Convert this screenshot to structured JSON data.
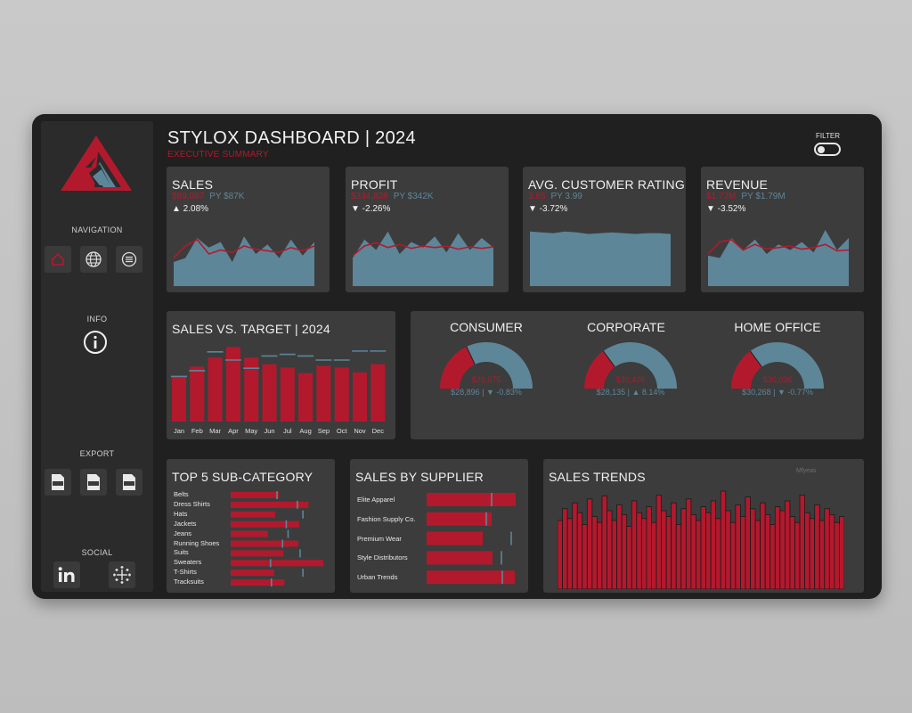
{
  "header": {
    "title": "STYLOX DASHBOARD  | 2024",
    "subtitle": "EXECUTIVE SUMMARY",
    "filter_label": "FILTER"
  },
  "sidebar": {
    "navigation_label": "NAVIGATION",
    "info_label": "INFO",
    "export_label": "EXPORT",
    "social_label": "SOCIAL",
    "nav_icons": [
      "home-icon",
      "globe-icon",
      "list-icon"
    ],
    "export_icons": [
      "png-file-icon",
      "pdf-file-icon",
      "ppt-file-icon"
    ],
    "social_icons": [
      "linkedin-icon",
      "tableau-icon"
    ]
  },
  "kpis": [
    {
      "title": "SALES",
      "current": "$89,087",
      "py": "PY $87K",
      "change": "▲ 2.08%"
    },
    {
      "title": "PROFIT",
      "current": "$334,828",
      "py": "PY $342K",
      "change": "▼ -2.26%"
    },
    {
      "title": "AVG. CUSTOMER RATING",
      "current": "3.85",
      "py": "PY 3.99",
      "change": "▼ -3.72%"
    },
    {
      "title": "REVENUE",
      "current": "$1.73M",
      "py": "PY $1.79M",
      "change": "▼ -3.52%"
    }
  ],
  "sales_vs_target": {
    "title": "SALES VS. TARGET | 2024",
    "months": [
      "Jan",
      "Feb",
      "Mar",
      "Apr",
      "May",
      "Jun",
      "Jul",
      "Aug",
      "Sep",
      "Oct",
      "Nov",
      "Dec"
    ]
  },
  "segments": [
    {
      "name": "CONSUMER",
      "value": "$29,075",
      "footer": "$28,896 |  ▼ -0.83%",
      "share": 0.36
    },
    {
      "name": "CORPORATE",
      "value": "$30,426",
      "footer": "$28,135 |  ▲ 8.14%",
      "share": 0.3
    },
    {
      "name": "HOME OFFICE",
      "value": "$30,036",
      "footer": "$30,268 |  ▼ -0.77%",
      "share": 0.3
    }
  ],
  "top5": {
    "title": "TOP 5 SUB-CATEGORY",
    "items": [
      "Belts",
      "Dress Shirts",
      "Hats",
      "Jackets",
      "Jeans",
      "Running Shoes",
      "Suits",
      "Sweaters",
      "T-Shirts",
      "Tracksuits"
    ]
  },
  "supplier": {
    "title": "SALES BY SUPPLIER",
    "items": [
      "Elite Apparel",
      "Fashion Supply Co.",
      "Premium Wear",
      "Style Distributors",
      "Urban Trends"
    ]
  },
  "trends": {
    "title": "SALES TRENDS",
    "legend": "Mfyeas"
  },
  "colors": {
    "accent_red": "#b3192d",
    "steel_blue": "#5d8699",
    "card_bg": "#3c3c3c",
    "panel_bg": "#202020"
  },
  "chart_data": [
    {
      "type": "area",
      "title": "SALES",
      "series": [
        {
          "values": [
            30,
            35,
            60,
            48,
            55,
            30,
            62,
            40,
            52,
            35,
            58,
            38,
            55
          ]
        },
        {
          "values": [
            35,
            50,
            58,
            40,
            45,
            42,
            50,
            46,
            44,
            42,
            48,
            44,
            50
          ]
        }
      ]
    },
    {
      "type": "area",
      "title": "PROFIT",
      "series": [
        {
          "values": [
            35,
            58,
            45,
            68,
            40,
            55,
            48,
            62,
            42,
            66,
            45,
            60,
            48
          ]
        },
        {
          "values": [
            38,
            50,
            54,
            48,
            52,
            47,
            50,
            48,
            50,
            46,
            49,
            47,
            49
          ]
        }
      ]
    },
    {
      "type": "area",
      "title": "AVG. CUSTOMER RATING",
      "series": [
        {
          "values": [
            68,
            67,
            66,
            68,
            67,
            65,
            66,
            67,
            66,
            65,
            66,
            66,
            65
          ]
        }
      ]
    },
    {
      "type": "area",
      "title": "REVENUE",
      "series": [
        {
          "values": [
            38,
            35,
            60,
            45,
            58,
            40,
            52,
            45,
            55,
            42,
            70,
            45,
            60
          ]
        },
        {
          "values": [
            40,
            55,
            58,
            45,
            52,
            46,
            48,
            50,
            46,
            48,
            52,
            44,
            45
          ]
        }
      ]
    },
    {
      "type": "bar",
      "title": "SALES VS. TARGET | 2024",
      "categories": [
        "Jan",
        "Feb",
        "Mar",
        "Apr",
        "May",
        "Jun",
        "Jul",
        "Aug",
        "Sep",
        "Oct",
        "Nov",
        "Dec"
      ],
      "series": [
        {
          "values": [
            56,
            67,
            78,
            91,
            78,
            70,
            66,
            59,
            68,
            66,
            60,
            70
          ]
        },
        {
          "values": [
            55,
            62,
            85,
            75,
            65,
            80,
            82,
            80,
            75,
            75,
            86,
            86
          ]
        }
      ]
    },
    {
      "type": "bar",
      "title": "TOP 5 SUB-CATEGORY",
      "categories": [
        "Belts",
        "Dress Shirts",
        "Hats",
        "Jackets",
        "Jeans",
        "Running Shoes",
        "Suits",
        "Sweaters",
        "T-Shirts",
        "Tracksuits"
      ],
      "series": [
        {
          "values": [
            52,
            84,
            48,
            74,
            40,
            73,
            57,
            100,
            47,
            58
          ]
        },
        {
          "values": [
            50,
            72,
            78,
            60,
            62,
            56,
            75,
            43,
            78,
            44
          ]
        }
      ]
    },
    {
      "type": "bar",
      "title": "SALES BY SUPPLIER",
      "categories": [
        "Elite Apparel",
        "Fashion Supply Co.",
        "Premium Wear",
        "Style Distributors",
        "Urban Trends"
      ],
      "series": [
        {
          "values": [
            100,
            73,
            63,
            74,
            99
          ]
        },
        {
          "values": [
            73,
            67,
            95,
            84,
            85
          ]
        }
      ]
    },
    {
      "type": "bar",
      "title": "SALES TRENDS",
      "values": [
        70,
        82,
        72,
        88,
        78,
        66,
        92,
        74,
        68,
        95,
        80,
        70,
        86,
        76,
        64,
        90,
        78,
        72,
        84,
        68,
        96,
        80,
        74,
        88,
        66,
        82,
        92,
        76,
        70,
        84,
        78,
        90,
        72,
        100,
        80,
        68,
        86,
        74,
        94,
        82,
        70,
        88,
        76,
        66,
        84,
        80,
        90,
        74,
        68,
        96,
        78,
        72,
        86,
        70,
        82,
        76,
        68,
        74
      ]
    }
  ]
}
